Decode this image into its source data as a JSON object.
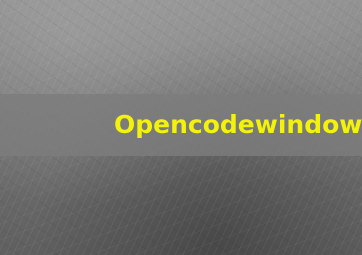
{
  "banner": {
    "text": "Opencodewindows"
  },
  "colors": {
    "banner_text": "#f2f20a",
    "banner_bg": "#7d7d7d"
  }
}
